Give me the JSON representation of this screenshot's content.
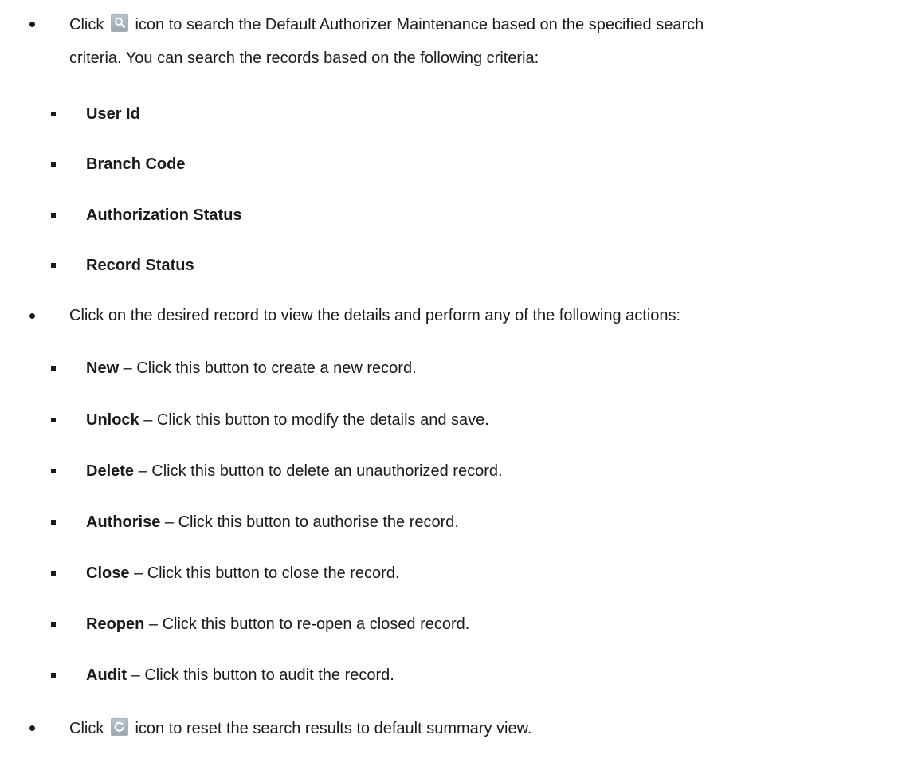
{
  "bullet1": {
    "line1_a": "Click",
    "line1_b": "icon to search the Default Authorizer Maintenance based on the specified search",
    "line2": "criteria. You can search the records based on the following criteria:",
    "criteria": [
      "User Id",
      "Branch Code",
      "Authorization Status",
      "Record Status"
    ]
  },
  "bullet2": {
    "text": "Click on the desired record to view the details and perform any of the following actions:",
    "actions": [
      {
        "name": "New",
        "desc": " – Click this button to create a new record."
      },
      {
        "name": "Unlock",
        "desc": " – Click this button to modify the details and save."
      },
      {
        "name": "Delete",
        "desc": " – Click this button to delete an unauthorized record."
      },
      {
        "name": "Authorise",
        "desc": " – Click this button to authorise the record."
      },
      {
        "name": "Close",
        "desc": " – Click this button to close the record."
      },
      {
        "name": "Reopen",
        "desc": " – Click this button to re-open a closed record."
      },
      {
        "name": "Audit",
        "desc": " – Click this button to audit the record."
      }
    ]
  },
  "bullet3": {
    "a": "Click",
    "b": "icon to reset the search results to default summary view."
  },
  "icons": {
    "search": "search-icon",
    "reset": "refresh-icon"
  }
}
